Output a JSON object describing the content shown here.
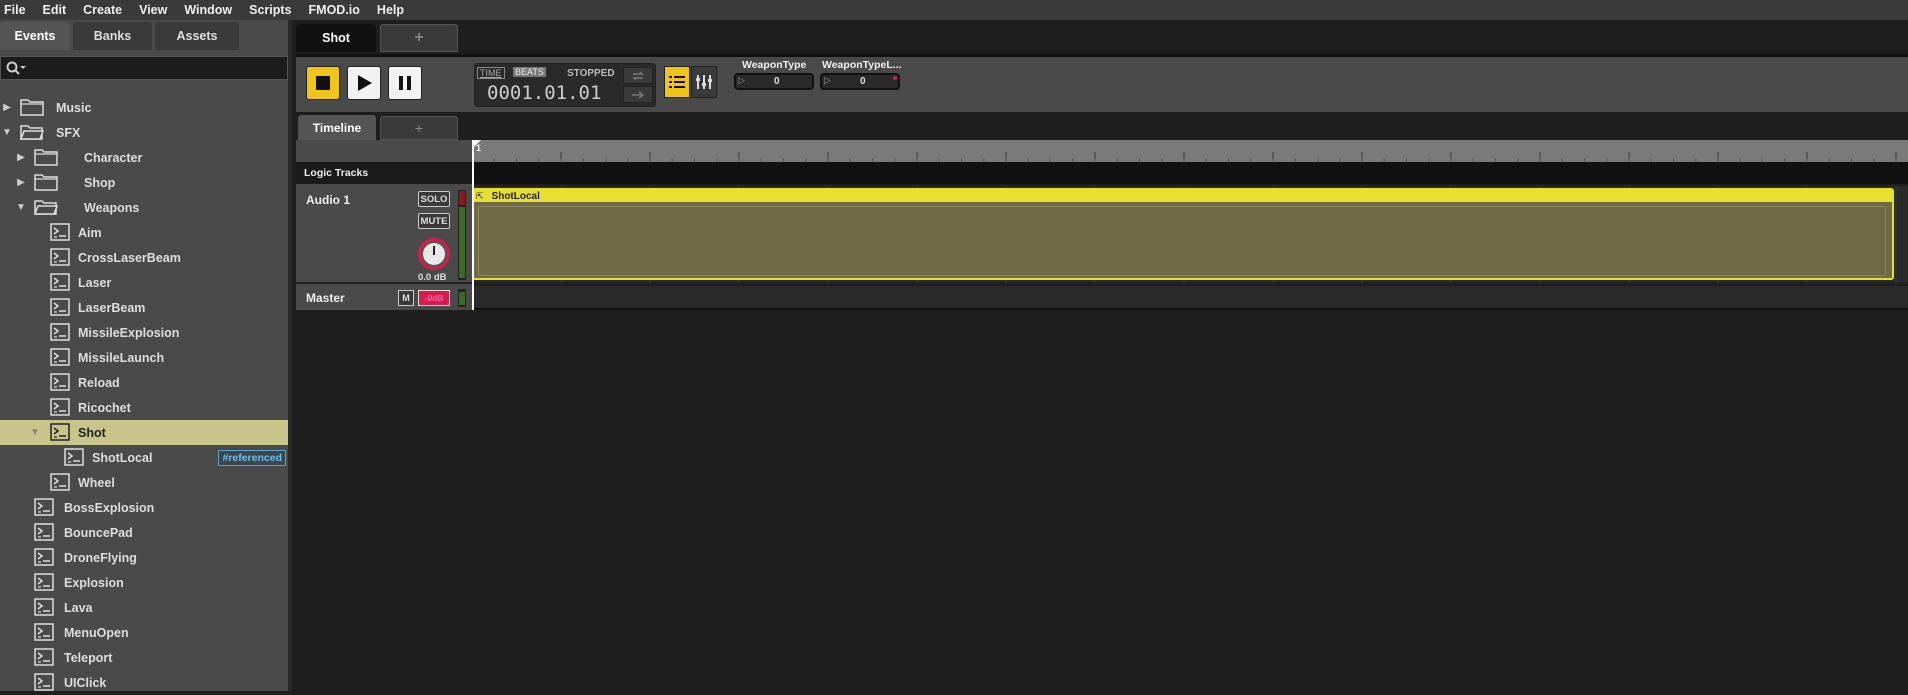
{
  "menu": [
    "File",
    "Edit",
    "Create",
    "View",
    "Window",
    "Scripts",
    "FMOD.io",
    "Help"
  ],
  "browser": {
    "tabs": [
      "Events",
      "Banks",
      "Assets"
    ],
    "search_placeholder": "",
    "tree": [
      {
        "label": "Music",
        "type": "folder",
        "depth": 0,
        "expanded": false
      },
      {
        "label": "SFX",
        "type": "folder",
        "depth": 0,
        "expanded": true
      },
      {
        "label": "Character",
        "type": "folder",
        "depth": 1,
        "expanded": false
      },
      {
        "label": "Shop",
        "type": "folder",
        "depth": 1,
        "expanded": false
      },
      {
        "label": "Weapons",
        "type": "folder",
        "depth": 1,
        "expanded": true
      },
      {
        "label": "Aim",
        "type": "event",
        "depth": 2
      },
      {
        "label": "CrossLaserBeam",
        "type": "event",
        "depth": 2
      },
      {
        "label": "Laser",
        "type": "event",
        "depth": 2
      },
      {
        "label": "LaserBeam",
        "type": "event",
        "depth": 2
      },
      {
        "label": "MissileExplosion",
        "type": "event",
        "depth": 2
      },
      {
        "label": "MissileLaunch",
        "type": "event",
        "depth": 2
      },
      {
        "label": "Reload",
        "type": "event",
        "depth": 2
      },
      {
        "label": "Ricochet",
        "type": "event",
        "depth": 2
      },
      {
        "label": "Shot",
        "type": "event",
        "depth": 2,
        "expanded": true,
        "selected": true
      },
      {
        "label": "ShotLocal",
        "type": "event",
        "depth": 3,
        "badge": "#referenced"
      },
      {
        "label": "Wheel",
        "type": "event",
        "depth": 2
      },
      {
        "label": "BossExplosion",
        "type": "event",
        "depth": 1
      },
      {
        "label": "BouncePad",
        "type": "event",
        "depth": 1
      },
      {
        "label": "DroneFlying",
        "type": "event",
        "depth": 1
      },
      {
        "label": "Explosion",
        "type": "event",
        "depth": 1
      },
      {
        "label": "Lava",
        "type": "event",
        "depth": 1
      },
      {
        "label": "MenuOpen",
        "type": "event",
        "depth": 1
      },
      {
        "label": "Teleport",
        "type": "event",
        "depth": 1
      },
      {
        "label": "UIClick",
        "type": "event",
        "depth": 1
      }
    ]
  },
  "editor": {
    "event_tab": "Shot",
    "add_tab": "+",
    "time_mode": "TIME",
    "beats_mode": "BEATS",
    "status": "STOPPED",
    "position": "0001.01.01",
    "parameters": [
      {
        "name": "WeaponType",
        "value": "0"
      },
      {
        "name": "WeaponTypeL...",
        "value": "0"
      }
    ],
    "sub_tabs": [
      "Timeline",
      "+"
    ],
    "ruler_start": "1",
    "logic_tracks": "Logic Tracks",
    "tracks": [
      {
        "name": "Audio 1",
        "solo": "SOLO",
        "mute": "MUTE",
        "volume": "0.0 dB",
        "instrument": "ShotLocal"
      }
    ],
    "master": {
      "name": "Master",
      "mute": "M",
      "meter": "-0dB"
    }
  },
  "colors": {
    "accent_yellow": "#f0c419",
    "selected_row": "#c9c48a",
    "instrument_bar": "#e8e030",
    "instrument_body": "#6e6a46",
    "knob_ring": "#d81b4a"
  }
}
